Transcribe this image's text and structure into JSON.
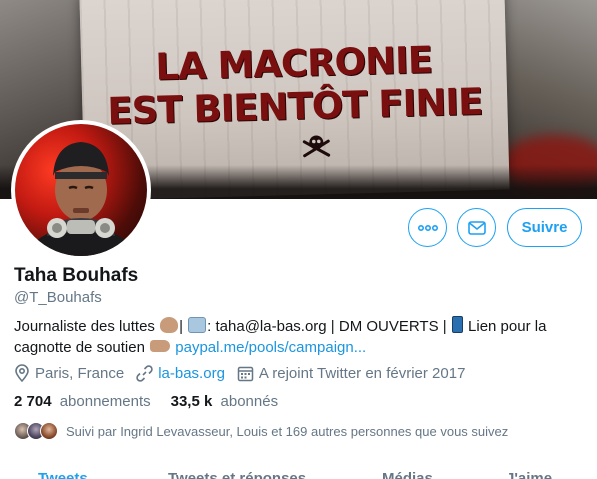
{
  "banner": {
    "slogan_line1": "LA MACRONIE",
    "slogan_line2": "EST BIENTÔT FINIE"
  },
  "actions": {
    "more_icon": "more-icon",
    "message_icon": "envelope-icon",
    "follow_label": "Suivre"
  },
  "profile": {
    "name": "Taha Bouhafs",
    "handle": "@T_Bouhafs",
    "bio": {
      "part1": "Journaliste des luttes",
      "sep1": "|",
      "email_prefix": ": taha@la-bas.org | DM OUVERTS |",
      "part2": "Lien pour la cagnotte de soutien",
      "link": "paypal.me/pools/campaign..."
    },
    "location": "Paris, France",
    "website": "la-bas.org",
    "joined": "A rejoint Twitter en février 2017"
  },
  "stats": {
    "following_count": "2 704",
    "following_label": "abonnements",
    "followers_count": "33,5 k",
    "followers_label": "abonnés"
  },
  "followed_by": "Suivi par Ingrid Levavasseur, Louis et 169 autres personnes que vous suivez",
  "tabs": [
    "Tweets",
    "Tweets et réponses",
    "Médias",
    "J'aime"
  ],
  "colors": {
    "accent": "#1da1f2",
    "link": "#1b95e0",
    "secondary_text": "#657786"
  }
}
